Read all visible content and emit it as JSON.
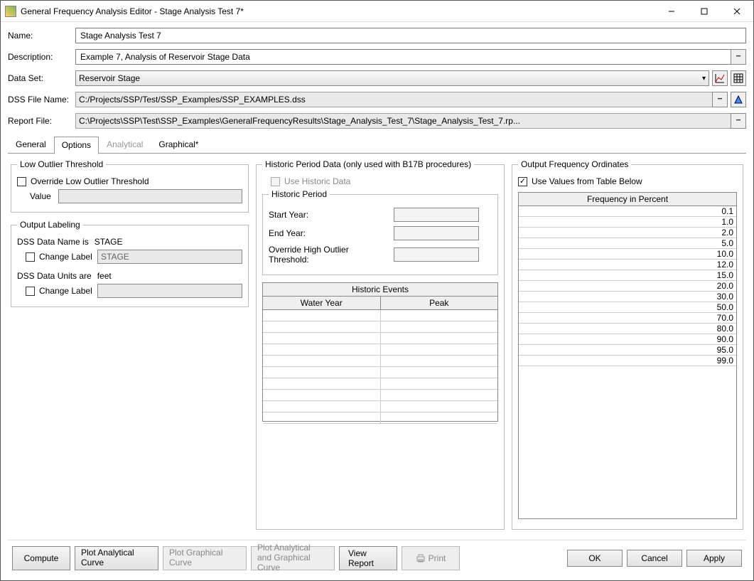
{
  "window": {
    "title": "General Frequency Analysis Editor - Stage Analysis Test 7*"
  },
  "labels": {
    "name": "Name:",
    "description": "Description:",
    "dataset": "Data Set:",
    "dssfile": "DSS File Name:",
    "reportfile": "Report File:"
  },
  "fields": {
    "name": "Stage Analysis Test 7",
    "description": "Example 7, Analysis of Reservoir Stage Data",
    "dataset": "Reservoir Stage",
    "dssfile": "C:/Projects/SSP/Test/SSP_Examples/SSP_EXAMPLES.dss",
    "reportfile": "C:\\Projects\\SSP\\Test\\SSP_Examples\\GeneralFrequencyResults\\Stage_Analysis_Test_7\\Stage_Analysis_Test_7.rp..."
  },
  "tabs": {
    "general": "General",
    "options": "Options",
    "analytical": "Analytical",
    "graphical": "Graphical*"
  },
  "lowoutlier": {
    "legend": "Low Outlier Threshold",
    "override": "Override Low Outlier Threshold",
    "value_label": "Value"
  },
  "outputlabel": {
    "legend": "Output Labeling",
    "dssname_is": "DSS Data Name is",
    "dssname_val": "STAGE",
    "change_label": "Change Label",
    "stage_val": "STAGE",
    "dssunits_are": "DSS Data Units are",
    "units_val": "feet"
  },
  "historic": {
    "legend": "Historic Period Data (only used with B17B procedures)",
    "use": "Use Historic Data",
    "period_legend": "Historic Period",
    "start": "Start Year:",
    "end": "End Year:",
    "override": "Override High Outlier Threshold:",
    "events_title": "Historic Events",
    "col1": "Water Year",
    "col2": "Peak"
  },
  "ordinates": {
    "legend": "Output Frequency Ordinates",
    "use": "Use Values from Table Below",
    "header": "Frequency in Percent",
    "values": [
      "0.1",
      "1.0",
      "2.0",
      "5.0",
      "10.0",
      "12.0",
      "15.0",
      "20.0",
      "30.0",
      "50.0",
      "70.0",
      "80.0",
      "90.0",
      "95.0",
      "99.0"
    ]
  },
  "buttons": {
    "compute": "Compute",
    "plot_analytical1": "Plot Analytical",
    "plot_analytical2": "Curve",
    "plot_graphical1": "Plot Graphical",
    "plot_graphical2": "Curve",
    "plot_both1": "Plot Analytical",
    "plot_both2": "and Graphical Curve",
    "view_report": "View Report",
    "print": "Print",
    "ok": "OK",
    "cancel": "Cancel",
    "apply": "Apply"
  }
}
